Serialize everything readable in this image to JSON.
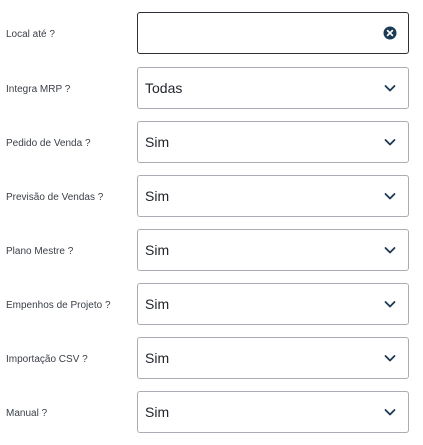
{
  "fields": [
    {
      "label": "Local até ?",
      "type": "text",
      "value": "",
      "icon": "clear-icon"
    },
    {
      "label": "Integra MRP ?",
      "type": "select",
      "value": "Todas",
      "icon": "chevron-down-icon"
    },
    {
      "label": "Pedido de Venda ?",
      "type": "select",
      "value": "Sim",
      "icon": "chevron-down-icon"
    },
    {
      "label": "Previsão de Vendas ?",
      "type": "select",
      "value": "Sim",
      "icon": "chevron-down-icon"
    },
    {
      "label": "Plano Mestre ?",
      "type": "select",
      "value": "Sim",
      "icon": "chevron-down-icon"
    },
    {
      "label": "Empenhos de Projeto ?",
      "type": "select",
      "value": "Sim",
      "icon": "chevron-down-icon"
    },
    {
      "label": "Importação CSV ?",
      "type": "select",
      "value": "Sim",
      "icon": "chevron-down-icon"
    },
    {
      "label": "Manual ?",
      "type": "select",
      "value": "Sim",
      "icon": "chevron-down-icon"
    }
  ],
  "colors": {
    "icon": "#1b3a57",
    "border": "#a9adb3",
    "active_border": "#2c3038"
  }
}
